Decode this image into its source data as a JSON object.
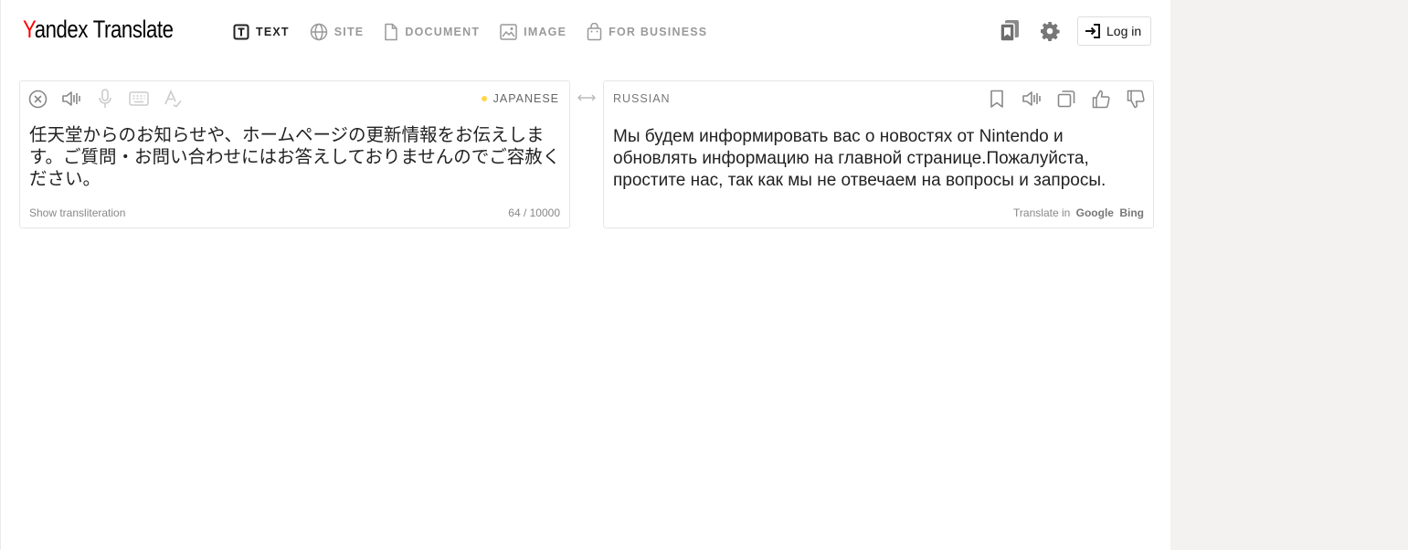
{
  "header": {
    "logo_first": "Y",
    "logo_rest": "andex",
    "logo_product": "Translate",
    "nav": [
      {
        "label": "TEXT",
        "icon": "text-icon",
        "active": true
      },
      {
        "label": "SITE",
        "icon": "globe-icon",
        "active": false
      },
      {
        "label": "DOCUMENT",
        "icon": "document-icon",
        "active": false
      },
      {
        "label": "IMAGE",
        "icon": "image-icon",
        "active": false
      },
      {
        "label": "FOR BUSINESS",
        "icon": "briefcase-icon",
        "active": false
      }
    ],
    "login_label": "Log in"
  },
  "source": {
    "language": "JAPANESE",
    "text": " 任天堂からのお知らせや、ホームページの更新情報をお伝えします。ご質問・お問い合わせにはお答えしておりませんのでご容赦ください。",
    "show_transliteration": "Show transliteration",
    "char_count": "64 / 10000"
  },
  "target": {
    "language": "RUSSIAN",
    "text": "Мы будем информировать вас о новостях от Nintendo и обновлять информацию на главной странице.Пожалуйста, простите нас, так как мы не отвечаем на вопросы и запросы.",
    "translate_in": "Translate in",
    "google": "Google",
    "bing": "Bing"
  },
  "colors": {
    "brand_red": "#ff0000",
    "dot_yellow": "#ffd64a",
    "gutter": "#f3f2f1"
  }
}
